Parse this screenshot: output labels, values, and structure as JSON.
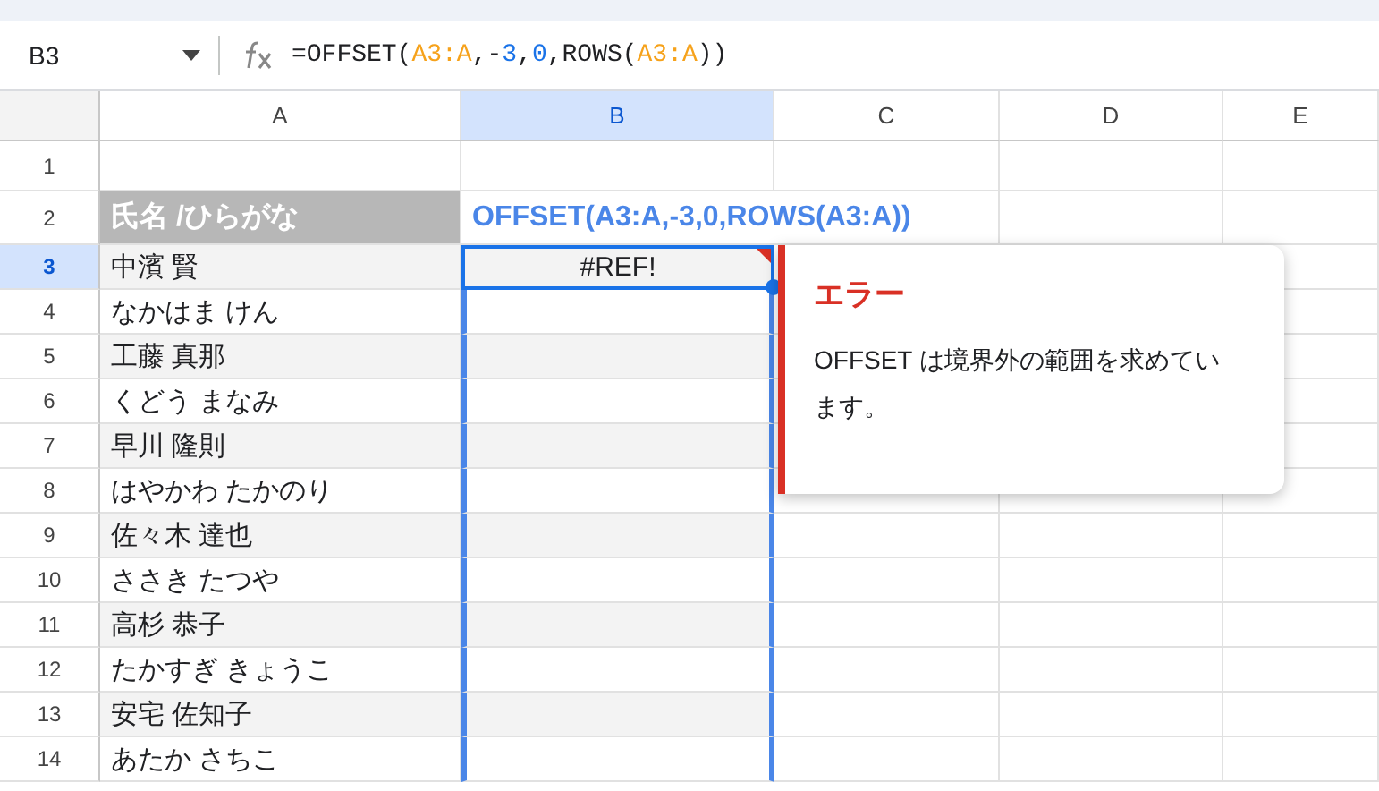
{
  "name_box": {
    "value": "B3"
  },
  "formula_bar": {
    "tokens": [
      {
        "kind": "text",
        "text": "=OFFSET("
      },
      {
        "kind": "ref",
        "text": "A3:A"
      },
      {
        "kind": "text",
        "text": ",-"
      },
      {
        "kind": "number",
        "text": "3"
      },
      {
        "kind": "text",
        "text": ","
      },
      {
        "kind": "number",
        "text": "0"
      },
      {
        "kind": "text",
        "text": ",ROWS("
      },
      {
        "kind": "ref",
        "text": "A3:A"
      },
      {
        "kind": "text",
        "text": "))"
      }
    ]
  },
  "columns": [
    {
      "label": "A",
      "selected": false
    },
    {
      "label": "B",
      "selected": true
    },
    {
      "label": "C",
      "selected": false
    },
    {
      "label": "D",
      "selected": false
    },
    {
      "label": "E",
      "selected": false
    }
  ],
  "rows": [
    {
      "number": "1",
      "selected": false,
      "banded": false,
      "a": {
        "kind": "plain"
      },
      "b": {
        "kind": "plain",
        "selected": false,
        "in_range": false,
        "error": false
      }
    },
    {
      "number": "2",
      "selected": false,
      "banded": false,
      "a": {
        "kind": "header",
        "text": "氏名 /ひらがな"
      },
      "b": {
        "kind": "formula",
        "text": "OFFSET(A3:A,-3,0,ROWS(A3:A))",
        "selected": false,
        "in_range": false,
        "error": false
      }
    },
    {
      "number": "3",
      "selected": true,
      "banded": true,
      "a": {
        "kind": "plain",
        "text": "中濱 賢"
      },
      "b": {
        "kind": "plain",
        "text": "#REF!",
        "selected": true,
        "in_range": true,
        "error": true
      }
    },
    {
      "number": "4",
      "selected": false,
      "banded": false,
      "a": {
        "kind": "plain",
        "text": "なかはま けん"
      },
      "b": {
        "kind": "plain",
        "selected": false,
        "in_range": true,
        "error": false
      }
    },
    {
      "number": "5",
      "selected": false,
      "banded": true,
      "a": {
        "kind": "plain",
        "text": "工藤 真那"
      },
      "b": {
        "kind": "plain",
        "selected": false,
        "in_range": true,
        "error": false
      }
    },
    {
      "number": "6",
      "selected": false,
      "banded": false,
      "a": {
        "kind": "plain",
        "text": "くどう まなみ"
      },
      "b": {
        "kind": "plain",
        "selected": false,
        "in_range": true,
        "error": false
      }
    },
    {
      "number": "7",
      "selected": false,
      "banded": true,
      "a": {
        "kind": "plain",
        "text": "早川 隆則"
      },
      "b": {
        "kind": "plain",
        "selected": false,
        "in_range": true,
        "error": false
      }
    },
    {
      "number": "8",
      "selected": false,
      "banded": false,
      "a": {
        "kind": "plain",
        "text": "はやかわ たかのり"
      },
      "b": {
        "kind": "plain",
        "selected": false,
        "in_range": true,
        "error": false
      }
    },
    {
      "number": "9",
      "selected": false,
      "banded": true,
      "a": {
        "kind": "plain",
        "text": "佐々木 達也"
      },
      "b": {
        "kind": "plain",
        "selected": false,
        "in_range": true,
        "error": false
      }
    },
    {
      "number": "10",
      "selected": false,
      "banded": false,
      "a": {
        "kind": "plain",
        "text": "ささき たつや"
      },
      "b": {
        "kind": "plain",
        "selected": false,
        "in_range": true,
        "error": false
      }
    },
    {
      "number": "11",
      "selected": false,
      "banded": true,
      "a": {
        "kind": "plain",
        "text": "高杉 恭子"
      },
      "b": {
        "kind": "plain",
        "selected": false,
        "in_range": true,
        "error": false
      }
    },
    {
      "number": "12",
      "selected": false,
      "banded": false,
      "a": {
        "kind": "plain",
        "text": "たかすぎ きょうこ"
      },
      "b": {
        "kind": "plain",
        "selected": false,
        "in_range": true,
        "error": false
      }
    },
    {
      "number": "13",
      "selected": false,
      "banded": true,
      "a": {
        "kind": "plain",
        "text": "安宅 佐知子"
      },
      "b": {
        "kind": "plain",
        "selected": false,
        "in_range": true,
        "error": false
      }
    },
    {
      "number": "14",
      "selected": false,
      "banded": false,
      "a": {
        "kind": "plain",
        "text": "あたか さちこ"
      },
      "b": {
        "kind": "plain",
        "selected": false,
        "in_range": true,
        "error": false
      }
    }
  ],
  "error_popup": {
    "title": "エラー",
    "message": "OFFSET は境界外の範囲を求めています。"
  }
}
